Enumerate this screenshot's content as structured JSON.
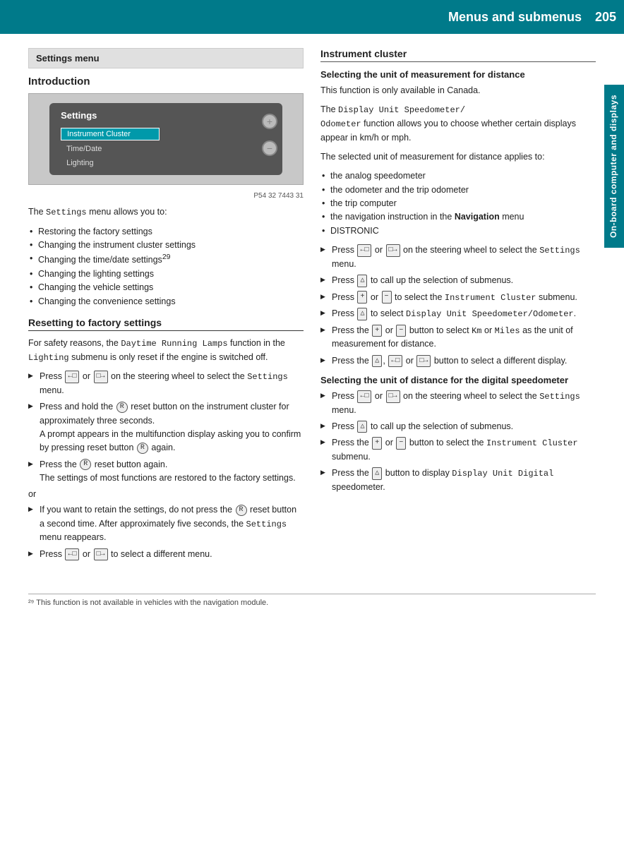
{
  "header": {
    "title": "Menus and submenus",
    "page_number": "205"
  },
  "side_tab": {
    "label": "On-board computer and displays"
  },
  "left_column": {
    "settings_menu_box": "Settings menu",
    "introduction_title": "Introduction",
    "dashboard_caption": "P54 32 7443 31",
    "dashboard_title": "Settings",
    "dashboard_items": [
      "Instrument Cluster",
      "Time/Date",
      "Lighting"
    ],
    "intro_text": "The Settings menu allows you to:",
    "intro_bullets": [
      "Restoring the factory settings",
      "Changing the instrument cluster settings",
      "Changing the time/date settings²⁹",
      "Changing the lighting settings",
      "Changing the vehicle settings",
      "Changing the convenience settings"
    ],
    "resetting_title": "Resetting to factory settings",
    "resetting_body1": "For safety reasons, the Daytime Running Lamps function in the Lighting submenu is only reset if the engine is switched off.",
    "resetting_steps": [
      "Press [←] or [→] on the steering wheel to select the Settings menu.",
      "Press and hold the (R) reset button on the instrument cluster for approximately three seconds. A prompt appears in the multifunction display asking you to confirm by pressing reset button (R) again.",
      "Press the (R) reset button again. The settings of most functions are restored to the factory settings."
    ],
    "or_text": "or",
    "resetting_alt_steps": [
      "If you want to retain the settings, do not press the (R) reset button a second time. After approximately five seconds, the Settings menu reappears.",
      "Press [←] or [→] to select a different menu."
    ]
  },
  "right_column": {
    "instrument_cluster_title": "Instrument cluster",
    "section1_title": "Selecting the unit of measurement for distance",
    "section1_body1": "This function is only available in Canada.",
    "section1_body2": "The Display Unit Speedometer/Odometer function allows you to choose whether certain displays appear in km/h or mph.",
    "section1_body3": "The selected unit of measurement for distance applies to:",
    "section1_bullets": [
      "the analog speedometer",
      "the odometer and the trip odometer",
      "the trip computer",
      "the navigation instruction in the Navigation menu",
      "DISTRONIC"
    ],
    "section1_steps": [
      "Press [←] or [→] on the steering wheel to select the Settings menu.",
      "Press [△] to call up the selection of submenus.",
      "Press [+] or [−] to select the Instrument Cluster submenu.",
      "Press [△] to select Display Unit Speedometer/Odometer.",
      "Press the [+] or [−] button to select Km or Miles as the unit of measurement for distance.",
      "Press the [△], [←] or [→] button to select a different display."
    ],
    "section2_title": "Selecting the unit of distance for the digital speedometer",
    "section2_steps": [
      "Press [←] or [→] on the steering wheel to select the Settings menu.",
      "Press [△] to call up the selection of submenus.",
      "Press the [+] or [−] button to select the Instrument Cluster submenu.",
      "Press the [△] button to display Display Unit Digital speedometer."
    ]
  },
  "footnote": "²⁹ This function is not available in vehicles with the navigation module."
}
